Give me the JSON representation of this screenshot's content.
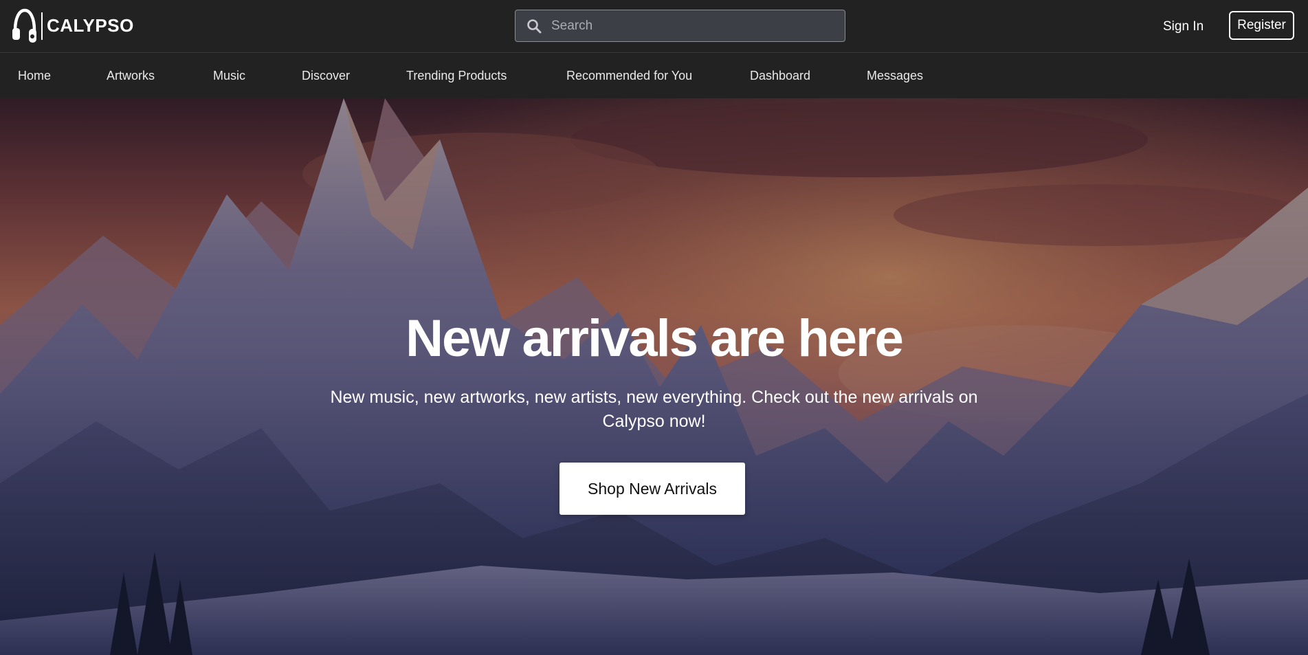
{
  "brand": {
    "name": "CALYPSO",
    "logo_icon": "headphones-icon"
  },
  "search": {
    "placeholder": "Search",
    "value": "",
    "icon": "search-icon"
  },
  "auth": {
    "sign_in_label": "Sign In",
    "register_label": "Register"
  },
  "nav": {
    "items": [
      {
        "label": "Home"
      },
      {
        "label": "Artworks"
      },
      {
        "label": "Music"
      },
      {
        "label": "Discover"
      },
      {
        "label": "Trending Products"
      },
      {
        "label": "Recommended for You"
      },
      {
        "label": "Dashboard"
      },
      {
        "label": "Messages"
      }
    ]
  },
  "hero": {
    "title": "New arrivals are here",
    "subtitle": "New music, new artworks, new artists, new everything. Check out the new arrivals on Calypso now!",
    "cta_label": "Shop New Arrivals"
  },
  "colors": {
    "header_bg": "#222222",
    "text": "#ffffff",
    "button_bg": "#ffffff"
  }
}
